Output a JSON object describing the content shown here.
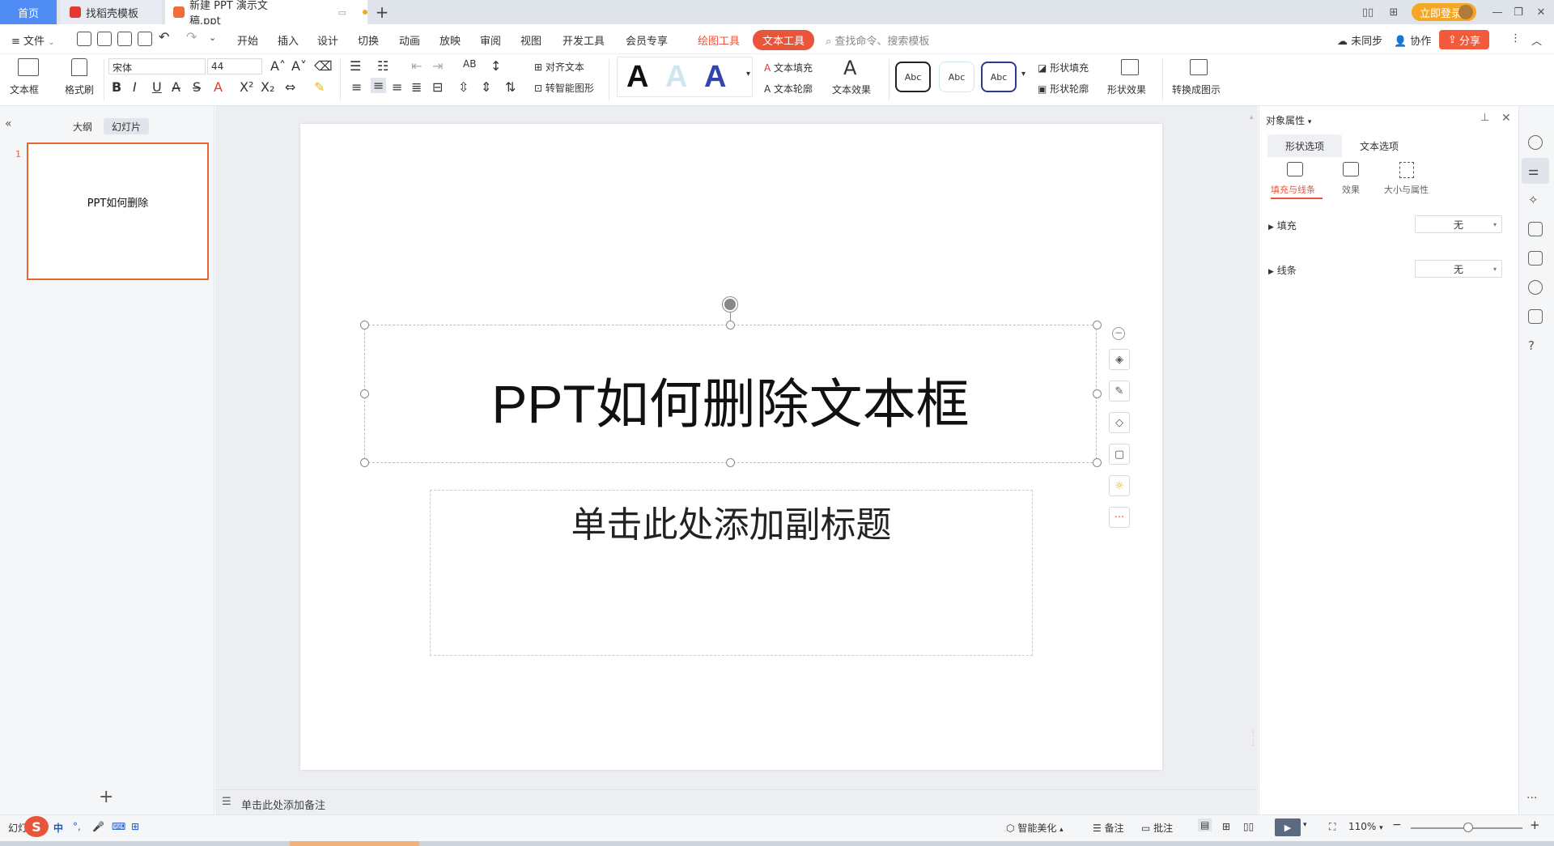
{
  "tabs": {
    "home": "首页",
    "templates": "找稻壳模板",
    "document": "新建 PPT 演示文稿.ppt",
    "add": "+"
  },
  "titlebar": {
    "login": "立即登录"
  },
  "menu": {
    "file": "文件",
    "items": [
      "开始",
      "插入",
      "设计",
      "切换",
      "动画",
      "放映",
      "审阅",
      "视图",
      "开发工具",
      "会员专享"
    ],
    "draw_tools": "绘图工具",
    "text_tools": "文本工具",
    "search_placeholder": "查找命令、搜索模板",
    "sync": "未同步",
    "collab": "协作",
    "share": "分享"
  },
  "ribbon": {
    "textbox": "文本框",
    "format_painter": "格式刷",
    "font_name": "宋体",
    "font_size": "44",
    "align_text": "对齐文本",
    "smart_shape": "转智能图形",
    "text_fill": "文本填充",
    "text_outline": "文本轮廓",
    "text_effect": "文本效果",
    "style_sample": "Abc",
    "shape_fill": "形状填充",
    "shape_outline": "形状轮廓",
    "shape_effect": "形状效果",
    "convert_diagram": "转换成图示",
    "big_a": "A"
  },
  "left_panel": {
    "outline_tab": "大纲",
    "slides_tab": "幻灯片",
    "slide_number": "1",
    "thumb_title": "PPT如何删除"
  },
  "slide": {
    "title": "PPT如何删除文本框",
    "subtitle_placeholder": "单击此处添加副标题"
  },
  "notes": {
    "placeholder": "单击此处添加备注"
  },
  "right_panel": {
    "title": "对象属性",
    "tab_shape": "形状选项",
    "tab_text": "文本选项",
    "sub_fill_line": "填充与线条",
    "sub_effect": "效果",
    "sub_size": "大小与属性",
    "fill_label": "填充",
    "fill_value": "无",
    "line_label": "线条",
    "line_value": "无"
  },
  "status": {
    "slide_label": "幻灯",
    "ime": "中",
    "smart_beautify": "智能美化",
    "notes": "备注",
    "comments": "批注",
    "zoom": "110%"
  },
  "colors": {
    "accent": "#e8553a",
    "home_tab": "#4f8df5",
    "login": "#f5a623",
    "selected_thumb": "#e8692f"
  }
}
